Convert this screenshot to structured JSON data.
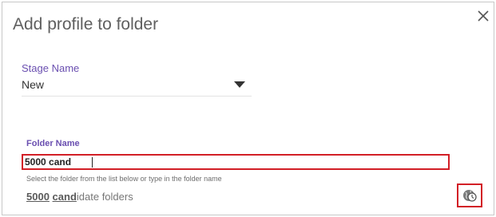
{
  "dialog": {
    "title": "Add profile to folder",
    "close_glyph": "×"
  },
  "stage": {
    "label": "Stage Name",
    "value": "New",
    "caret_icon": "dropdown-caret-icon"
  },
  "folder": {
    "label": "Folder Name",
    "value": "5000 cand",
    "helper": "Select the folder from the list below or type in the folder name",
    "suggestion": {
      "match_1": "5000",
      "space": " ",
      "match_2": "cand",
      "rest": "idate folders"
    },
    "action_icon": "globe-clock-icon"
  },
  "colors": {
    "accent_purple": "#6a4fb0",
    "highlight_red": "#d21f26",
    "title_gray": "#5f5f5f"
  }
}
